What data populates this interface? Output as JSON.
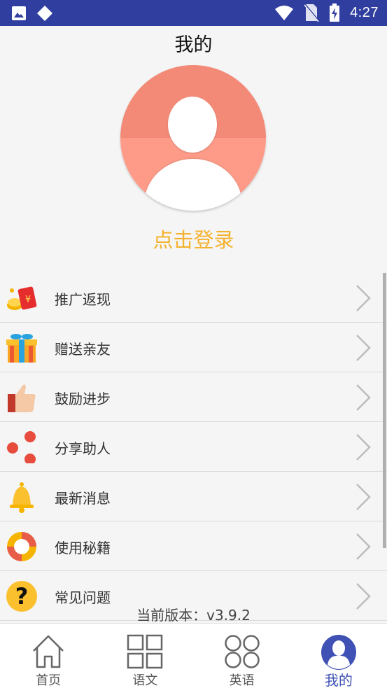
{
  "status_bar": {
    "time": "4:27",
    "left_icons": [
      "image-icon",
      "diamond-icon"
    ],
    "right_icons": [
      "wifi-icon",
      "no-sim-icon",
      "battery-charging-icon"
    ]
  },
  "header": {
    "title": "我的"
  },
  "profile": {
    "login_text": "点击登录"
  },
  "menu": {
    "items": [
      {
        "label": "推广返现",
        "icon": "red-envelope-icon"
      },
      {
        "label": "赠送亲友",
        "icon": "gift-icon"
      },
      {
        "label": "鼓励进步",
        "icon": "thumbs-up-icon"
      },
      {
        "label": "分享助人",
        "icon": "share-icon"
      },
      {
        "label": "最新消息",
        "icon": "bell-icon"
      },
      {
        "label": "使用秘籍",
        "icon": "lifebuoy-icon"
      },
      {
        "label": "常见问题",
        "icon": "question-icon"
      }
    ]
  },
  "version": "当前版本：v3.9.2",
  "tabbar": {
    "tabs": [
      {
        "label": "首页",
        "icon": "home-icon"
      },
      {
        "label": "语文",
        "icon": "grid-icon"
      },
      {
        "label": "英语",
        "icon": "circles-icon"
      },
      {
        "label": "我的",
        "icon": "user-icon",
        "active": true
      }
    ]
  },
  "colors": {
    "accent": "#3f51b5",
    "status_bar": "#303f9f",
    "login": "#f5b22f",
    "avatar": "#f38a77"
  }
}
